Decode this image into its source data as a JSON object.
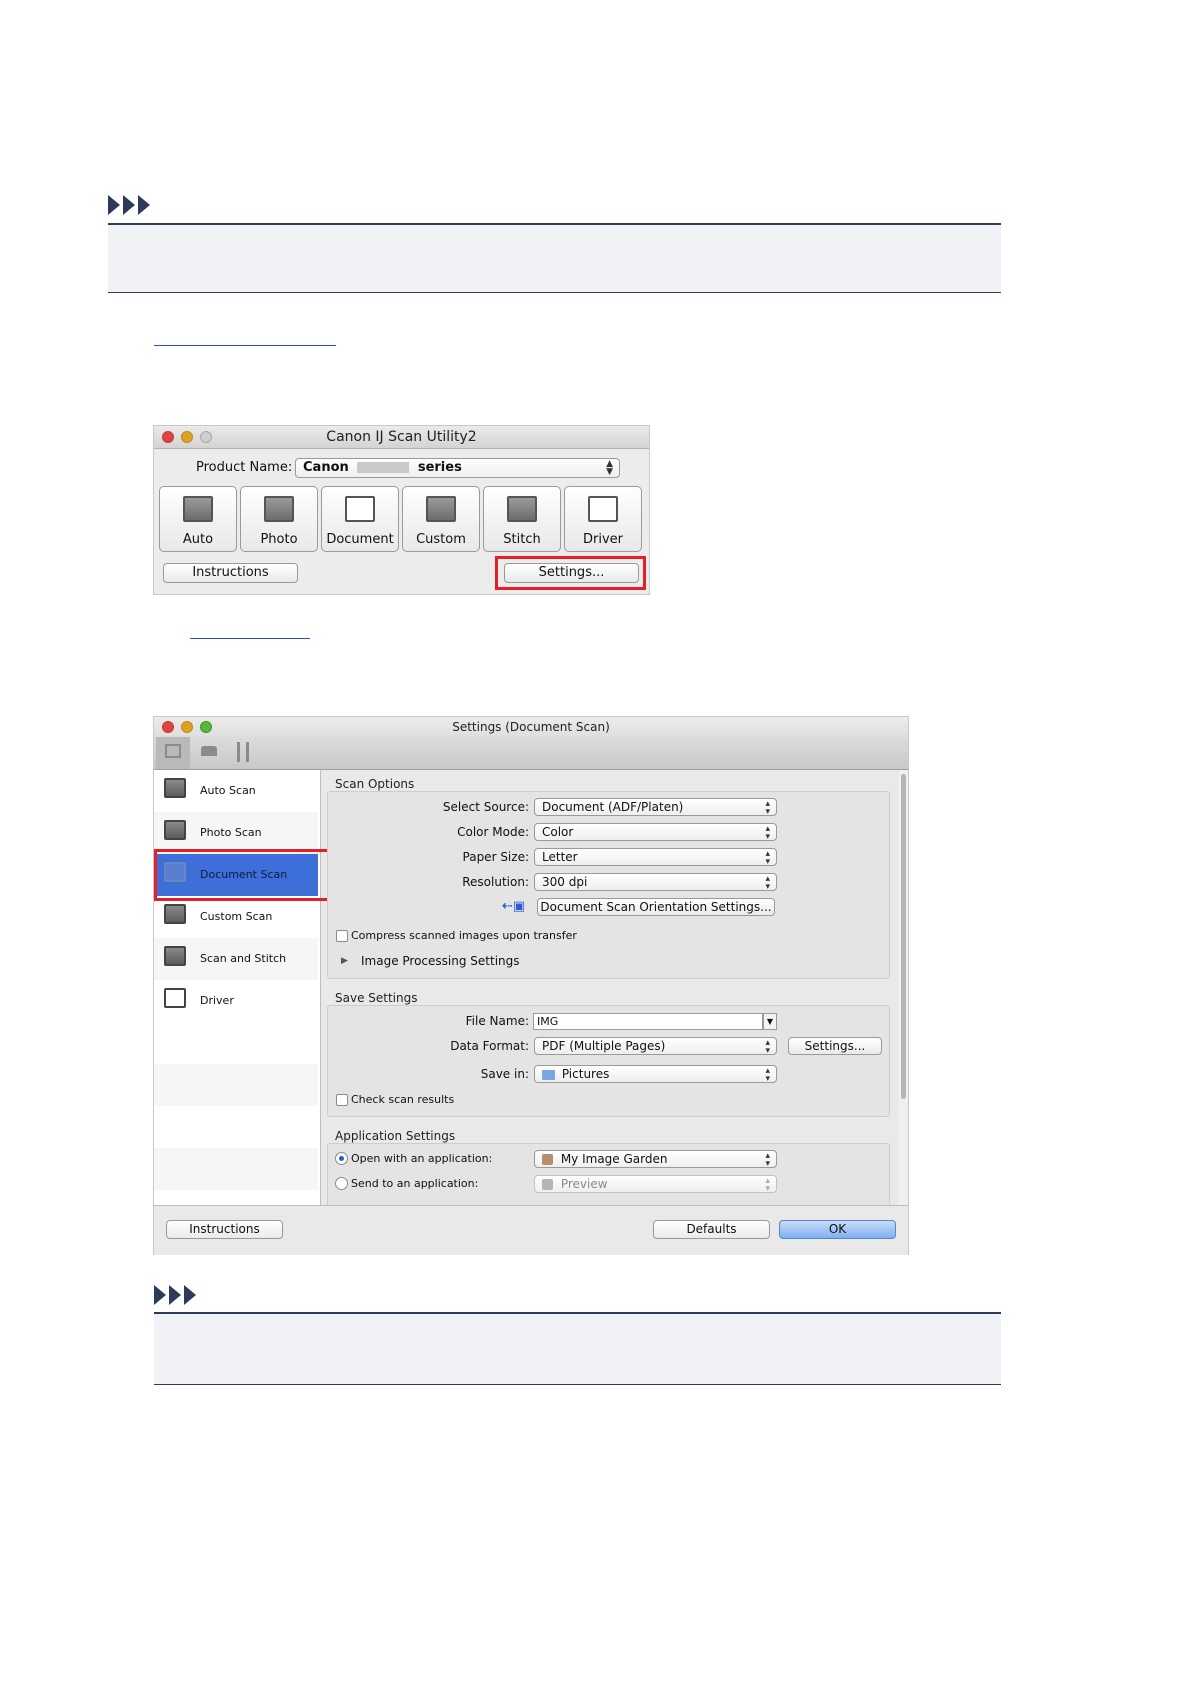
{
  "window1": {
    "title": "Canon IJ Scan Utility2",
    "product_label": "Product Name:",
    "product_value_prefix": "Canon",
    "product_value_suffix": "series",
    "buttons": [
      "Auto",
      "Photo",
      "Document",
      "Custom",
      "Stitch",
      "Driver"
    ],
    "instructions_label": "Instructions",
    "settings_label": "Settings..."
  },
  "window2": {
    "title": "Settings (Document Scan)",
    "sidebar": [
      "Auto Scan",
      "Photo Scan",
      "Document Scan",
      "Custom Scan",
      "Scan and Stitch",
      "Driver"
    ],
    "scan_options": {
      "section": "Scan Options",
      "select_source_label": "Select Source:",
      "select_source_value": "Document (ADF/Platen)",
      "color_mode_label": "Color Mode:",
      "color_mode_value": "Color",
      "paper_size_label": "Paper Size:",
      "paper_size_value": "Letter",
      "resolution_label": "Resolution:",
      "resolution_value": "300 dpi",
      "orientation_button": "Document Scan Orientation Settings...",
      "compress_label": "Compress scanned images upon transfer",
      "image_processing_label": "Image Processing Settings"
    },
    "save_settings": {
      "section": "Save Settings",
      "file_name_label": "File Name:",
      "file_name_value": "IMG",
      "data_format_label": "Data Format:",
      "data_format_value": "PDF (Multiple Pages)",
      "settings_button": "Settings...",
      "save_in_label": "Save in:",
      "save_in_value": "Pictures",
      "check_results_label": "Check scan results"
    },
    "app_settings": {
      "section": "Application Settings",
      "open_with_label": "Open with an application:",
      "open_with_value": "My Image Garden",
      "send_to_label": "Send to an application:",
      "send_to_value": "Preview"
    },
    "footer": {
      "instructions": "Instructions",
      "defaults": "Defaults",
      "ok": "OK"
    }
  },
  "colors": {
    "highlight_red": "#e41f26",
    "selection_blue": "#3e6fd8",
    "note_accent": "#2d3a5c",
    "link": "#2a4bd7"
  }
}
